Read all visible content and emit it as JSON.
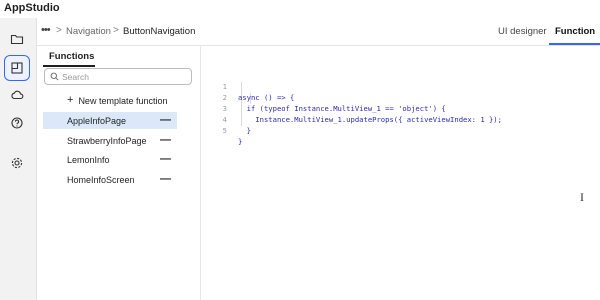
{
  "app": {
    "title": "AppStudio"
  },
  "rail": {
    "items": [
      {
        "icon": "folder-icon"
      },
      {
        "icon": "components-icon"
      },
      {
        "icon": "cloud-icon"
      },
      {
        "icon": "help-icon"
      },
      {
        "icon": "gear-icon"
      }
    ]
  },
  "breadcrumb": {
    "more": "•••",
    "sep": ">",
    "items": [
      "Navigation",
      "ButtonNavigation"
    ]
  },
  "tabs": {
    "designer": "UI designer",
    "function": "Function"
  },
  "functions": {
    "heading": "Functions",
    "search_placeholder": "Search",
    "new_label": "New template function",
    "items": [
      {
        "label": "AppleInfoPage",
        "selected": true
      },
      {
        "label": "StrawberryInfoPage",
        "selected": false
      },
      {
        "label": "LemonInfo",
        "selected": false
      },
      {
        "label": "HomeInfoScreen",
        "selected": false
      }
    ]
  },
  "code": {
    "lines": [
      {
        "n": "1",
        "text": "async () => {"
      },
      {
        "n": "2",
        "text": "  if (typeof Instance.MultiView_1 == 'object') {"
      },
      {
        "n": "3",
        "text": "    Instance.MultiView_1.updateProps({ activeViewIndex: 1 });"
      },
      {
        "n": "4",
        "text": "  }"
      },
      {
        "n": "5",
        "text": "}"
      }
    ]
  },
  "colors": {
    "accent": "#3366ff",
    "selected_bg": "#dbe8fa",
    "code_text": "#2b2bb2"
  }
}
